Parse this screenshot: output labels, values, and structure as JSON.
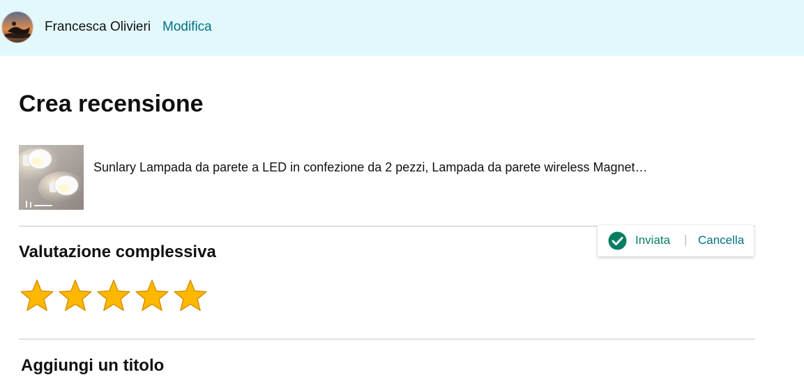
{
  "header": {
    "user_name": "Francesca Olivieri",
    "edit_label": "Modifica",
    "background": "#e3f8fb",
    "link_color": "#007185"
  },
  "main": {
    "title": "Crea recensione",
    "product": {
      "name": "Sunlary Lampada da parete a LED in confezione da 2 pezzi, Lampada da parete wireless Magnet…"
    },
    "rating_section": {
      "heading": "Valutazione complessiva",
      "rating": 5,
      "max_rating": 5,
      "star_color": "#ffb800"
    },
    "title_section": {
      "heading": "Aggiungi un titolo"
    }
  },
  "toast": {
    "status_label": "Inviata",
    "separator": "|",
    "cancel_label": "Cancella",
    "icon": "check-circle-icon",
    "status_color": "#067d62"
  }
}
